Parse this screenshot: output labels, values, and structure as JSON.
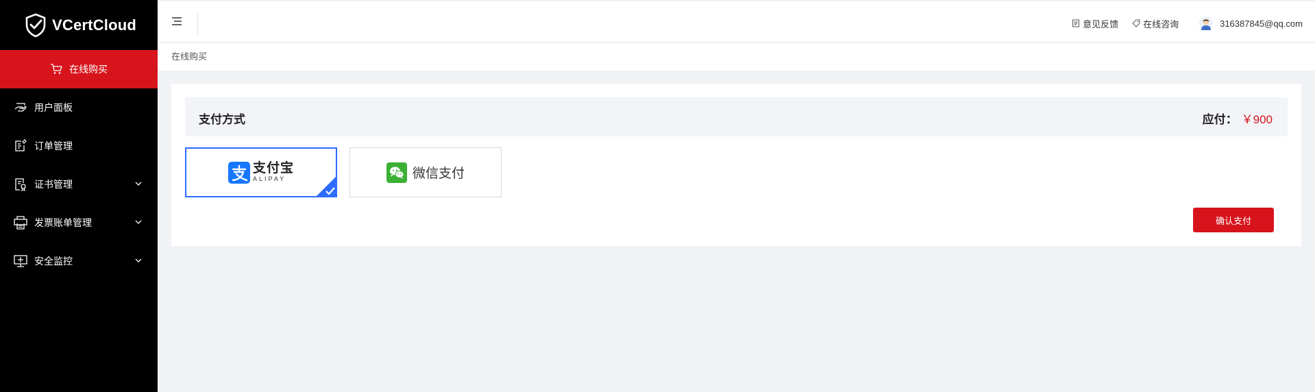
{
  "brand": {
    "name": "VCertCloud",
    "logo_icon": "shield-check-icon"
  },
  "sidebar": {
    "buy": {
      "label": "在线购买",
      "icon": "cart-icon"
    },
    "items": [
      {
        "label": "用户面板",
        "icon": "hand-icon",
        "has_submenu": false
      },
      {
        "label": "订单管理",
        "icon": "order-edit-icon",
        "has_submenu": false
      },
      {
        "label": "证书管理",
        "icon": "certificate-icon",
        "has_submenu": true
      },
      {
        "label": "发票账单管理",
        "icon": "invoice-printer-icon",
        "has_submenu": true
      },
      {
        "label": "安全监控",
        "icon": "monitor-icon",
        "has_submenu": true
      }
    ]
  },
  "topbar": {
    "feedback": "意见反馈",
    "consult": "在线咨询",
    "user_email": "316387845@qq.com"
  },
  "breadcrumb": "在线购买",
  "payment": {
    "title": "支付方式",
    "amount_label": "应付：",
    "amount_value": "￥900",
    "methods": [
      {
        "cn": "支付宝",
        "en": "ALIPAY",
        "selected": true
      },
      {
        "label": "微信支付",
        "selected": false
      }
    ],
    "confirm_label": "确认支付"
  },
  "colors": {
    "brand_red": "#d7141c",
    "sidebar_bg": "#000000",
    "select_blue": "#2d6cff",
    "alipay_blue": "#1677ff",
    "wechat_green": "#3cb034"
  }
}
